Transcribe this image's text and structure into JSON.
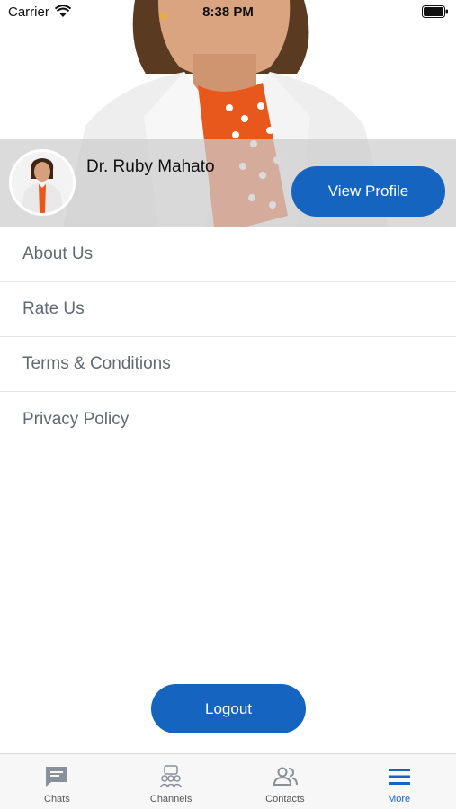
{
  "status_bar": {
    "carrier": "Carrier",
    "time": "8:38 PM"
  },
  "profile": {
    "name": "Dr. Ruby Mahato",
    "view_profile_label": "View Profile"
  },
  "menu": {
    "items": [
      {
        "label": "About Us"
      },
      {
        "label": "Rate Us"
      },
      {
        "label": "Terms & Conditions"
      },
      {
        "label": "Privacy Policy"
      }
    ]
  },
  "logout_label": "Logout",
  "tabbar": {
    "tabs": [
      {
        "label": "Chats",
        "icon": "chat-icon",
        "active": false
      },
      {
        "label": "Channels",
        "icon": "channels-icon",
        "active": false
      },
      {
        "label": "Contacts",
        "icon": "contacts-icon",
        "active": false
      },
      {
        "label": "More",
        "icon": "menu-icon",
        "active": true
      }
    ]
  },
  "colors": {
    "accent": "#1565c0",
    "menu_text": "#616a73",
    "inactive_icon": "#8a9099"
  }
}
